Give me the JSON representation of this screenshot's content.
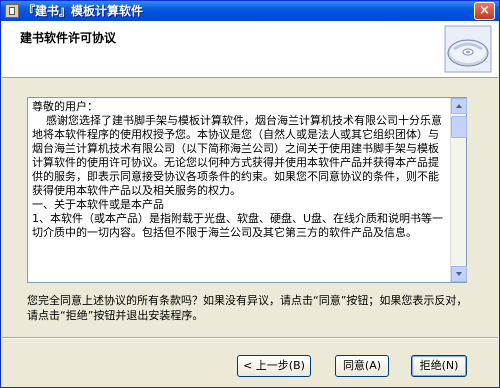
{
  "window": {
    "title": "『建书』模板计算软件",
    "close_label": "×"
  },
  "header": {
    "title": "建书软件许可协议",
    "art_icon": "cd-disc-icon"
  },
  "license": {
    "paragraphs": [
      "尊敬的用户：",
      "    感谢您选择了建书脚手架与模板计算软件，烟台海兰计算机技术有限公司十分乐意地将本软件程序的使用权授予您。本协议是您（自然人或是法人或其它组织团体）与烟台海兰计算机技术有限公司（以下简称海兰公司）之间关于使用建书脚手架与模板计算软件的使用许可协议。无论您以何种方式获得并使用本软件产品并获得本产品提供的服务，即表示同意接受协议各项条件的约束。如果您不同意协议的条件，则不能获得使用本软件产品以及相关服务的权力。",
      "一、关于本软件或是本产品",
      "1、本软件（或本产品）是指附载于光盘、软盘、硬盘、U盘、在线介质和说明书等一切介质中的一切内容。包括但不限于海兰公司及其它第三方的软件产品及信息。"
    ]
  },
  "question": "您完全同意上述协议的所有条款吗？如果没有异议，请点击“同意”按钮；如果您表示反对，请点击“拒绝”按钮并退出安装程序。",
  "buttons": {
    "back": "< 上一步(B)",
    "agree": "同意(A)",
    "reject": "拒绝(N)"
  }
}
